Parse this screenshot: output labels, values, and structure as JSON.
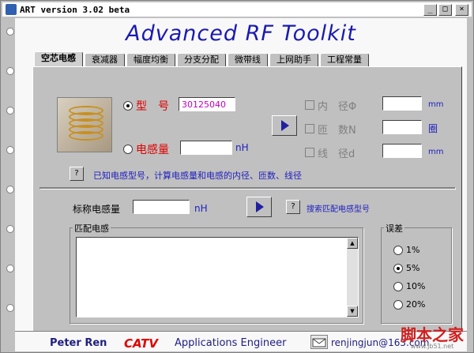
{
  "window": {
    "title": "ART version 3.02 beta",
    "buttons": {
      "minimize": "_",
      "maximize": "□",
      "close": "×"
    }
  },
  "app_title": "Advanced RF Toolkit",
  "tabs": [
    "空芯电感",
    "衰减器",
    "幅度均衡",
    "分支分配",
    "微带线",
    "上网助手",
    "工程常量"
  ],
  "inductor": {
    "model_label": "型　号",
    "model_value": "30125040",
    "inductance_label": "电感量",
    "inductance_value": "",
    "inductance_unit": "nH",
    "inner_diameter_label": "内　径Φ",
    "inner_diameter_unit": "mm",
    "turns_label": "匝　数N",
    "turns_unit": "圈",
    "wire_diameter_label": "线　径d",
    "wire_diameter_unit": "mm",
    "hint_text": "已知电感型号，计算电感量和电感的内径、匝数、线径"
  },
  "search": {
    "nominal_label": "标称电感量",
    "nominal_value": "",
    "nominal_unit": "nH",
    "search_label": "搜索匹配电感型号"
  },
  "match": {
    "group_label": "匹配电感"
  },
  "tolerance": {
    "group_label": "误差",
    "options": [
      "1%",
      "5%",
      "10%",
      "20%"
    ],
    "selected": "5%"
  },
  "footer": {
    "author": "Peter Ren",
    "brand": "CATV",
    "role": "Applications Engineer",
    "email": "renjingjun@163.com"
  },
  "watermark": {
    "text": "脚本之家",
    "url": "www.jb51.net"
  }
}
